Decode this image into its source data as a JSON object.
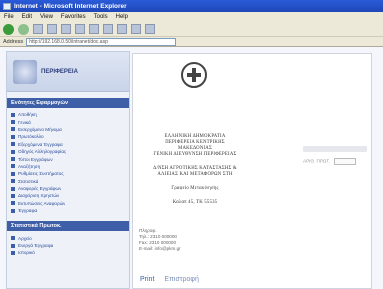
{
  "window": {
    "title": "Ιnternet - Microsoft Internet Explorer"
  },
  "menu": [
    "File",
    "Edit",
    "View",
    "Favorites",
    "Tools",
    "Help"
  ],
  "address": {
    "label": "Address",
    "url": "http://192.168.0.50/intranet/doc.asp"
  },
  "sidebar": {
    "logo_text": "ΠΕΡΙΦΕΡΕΙΑ",
    "section_title": "Ενότητες Εφαρμογών",
    "items": [
      "Αποθήκη",
      "Γενικά",
      "Εισερχόμενο Μήνυμα",
      "Πρωτόκολλο",
      "Εξερχόμενα Έγγραφα",
      "Οδηγός Αλληλογραφίας",
      "Τύποι Εγγράφων",
      "Αναζήτηση",
      "Ρυθμίσεις Συστήματος",
      "Στατιστικά",
      "Αναφορές Εγγράφων",
      "Διαχείριση Χρηστών",
      "Εκτυπώσεις Αναφορών",
      "Έγγραφα"
    ],
    "section2_title": "Στατιστικά Πρωτοκ.",
    "items2": [
      "Αρχείο",
      "Ενεργά Έγγραφα",
      "Ιστορικό"
    ]
  },
  "document": {
    "letterhead": [
      "ΕΛΛΗΝΙΚΗ ΔΗΜΟΚΡΑΤΙΑ",
      "ΠΕΡΙΦΕΡΕΙΑ ΚΕΝΤΡΙΚΗΣ",
      "ΜΑΚΕΔΟΝΙΑΣ",
      "ΓΕΝΙΚΗ ΔΙΕΥΘΥΝΣΗ ΠΕΡΙΦΕΡΕΙΑΣ"
    ],
    "unit": [
      "Δ/ΝΣΗ ΑΓΡΟΤΙΚΗΣ ΚΑΤΑΣΤΑΣΗΣ &",
      "ΑΛΙΕΙΑΣ ΚΑΙ ΜΕΤΑΦΟΡΩΝ ΣΤΗ"
    ],
    "office": "Γραφείο Μετακίνησης",
    "address_line": "Καλαπ 45, ΤΚ 55535",
    "contact": [
      "Πληροφ.",
      "Τηλ.: 2310 000000",
      "Fax: 2310 000000",
      "E-mail: info@pkm.gr"
    ],
    "right_label": "ΑΡΙΘ. ΠΡΩΤ."
  },
  "footer": {
    "print_label": "Print",
    "back_label": "Επιστροφή"
  }
}
